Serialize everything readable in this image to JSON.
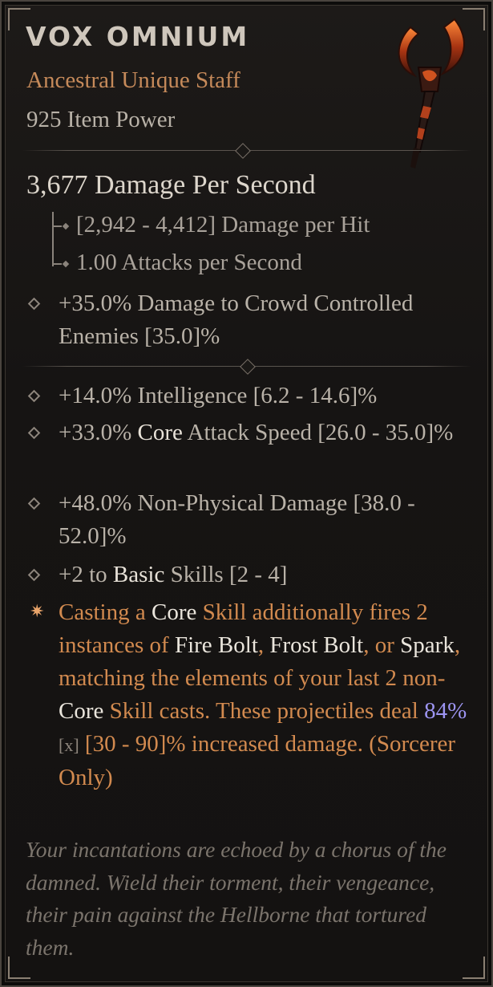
{
  "item": {
    "name": "VOX OMNIUM",
    "type": "Ancestral Unique Staff",
    "item_power": "925 Item Power",
    "icon": "staff-icon"
  },
  "stats": {
    "dps": "3,677 Damage Per Second",
    "damage_per_hit": "[2,942 - 4,412] Damage per Hit",
    "attacks_per_second": "1.00 Attacks per Second",
    "implicit": "+35.0% Damage to Crowd Controlled Enemies [35.0]%"
  },
  "affixes": [
    {
      "pre": "+14.0% Intelligence [6.2 - 14.6]%",
      "hl": "",
      "post": ""
    },
    {
      "pre": "+33.0% ",
      "hl": "Core",
      "post": " Attack Speed  [26.0 - 35.0]%"
    },
    {
      "pre": "+48.0% Non-Physical Damage [38.0 - 52.0]%",
      "hl": "",
      "post": ""
    },
    {
      "pre": "+2 to ",
      "hl": "Basic",
      "post": " Skills [2 - 4]"
    }
  ],
  "unique_power": {
    "p1": "Casting a ",
    "w1": "Core",
    "p2": " Skill additionally fires 2 instances of ",
    "w2": "Fire Bolt",
    "p3": ", ",
    "w3": "Frost Bolt",
    "p4": ", or ",
    "w4": "Spark",
    "p5": ", matching the elements of your last 2 non-",
    "w5": "Core",
    "p6": " Skill casts. These projectiles deal ",
    "value": "84%",
    "mark": "[x]",
    "p7": " [30 - 90]% increased damage. (Sorcerer Only)"
  },
  "flavor": "Your incantations are echoed by a chorus of the damned. Wield their torment, their vengeance, their pain against the Hellborne that tortured them.",
  "colors": {
    "unique": "#d28a4f",
    "highlight": "#e8e2d8",
    "value": "#9d95f2",
    "flavor": "#7b746c"
  }
}
